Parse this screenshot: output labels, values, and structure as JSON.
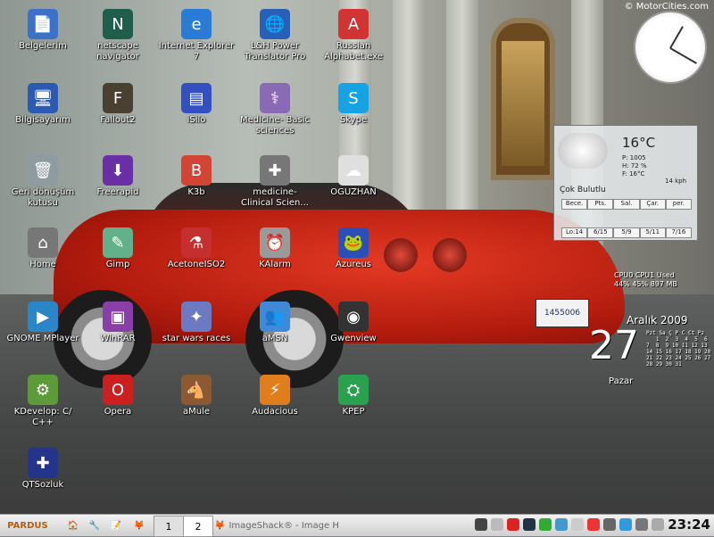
{
  "watermark": "© MotorCities.com",
  "desktop_icons": [
    {
      "label": "Belgelerim",
      "icon": "folder-documents-icon",
      "glyph": "📄",
      "bg": "#3d71c7"
    },
    {
      "label": "netscape navigator",
      "icon": "netscape-icon",
      "glyph": "N",
      "bg": "#1f5e4b"
    },
    {
      "label": "Internet Explorer 7",
      "icon": "ie-icon",
      "glyph": "e",
      "bg": "#2a7bd5"
    },
    {
      "label": "L&H Power Translator Pro",
      "icon": "globe-icon",
      "glyph": "🌐",
      "bg": "#2a5fb8"
    },
    {
      "label": "Russian Alphabet.exe",
      "icon": "russian-flag-icon",
      "glyph": "A",
      "bg": "#d23434"
    },
    {
      "label": "Bilgisayarım",
      "icon": "computer-icon",
      "glyph": "🖥",
      "bg": "#2c5ab0"
    },
    {
      "label": "Fallout2",
      "icon": "fallout-icon",
      "glyph": "F",
      "bg": "#4a4032"
    },
    {
      "label": "iSilo",
      "icon": "isilo-icon",
      "glyph": "▤",
      "bg": "#3450c0"
    },
    {
      "label": "Medicine- Basic sciences",
      "icon": "medicine-icon",
      "glyph": "⚕",
      "bg": "#8a6ab5"
    },
    {
      "label": "Skype",
      "icon": "skype-icon",
      "glyph": "S",
      "bg": "#16a3e3"
    },
    {
      "label": "Geri dönüşüm kutusu",
      "icon": "recycle-bin-icon",
      "glyph": "🗑",
      "bg": "#8e9ca2"
    },
    {
      "label": "Freerapid",
      "icon": "download-icon",
      "glyph": "⬇",
      "bg": "#6a2fa5"
    },
    {
      "label": "K3b",
      "icon": "k3b-icon",
      "glyph": "B",
      "bg": "#d24534"
    },
    {
      "label": "medicine- Clinical Scien...",
      "icon": "stethoscope-icon",
      "glyph": "✚",
      "bg": "#777777"
    },
    {
      "label": "OGUZHAN",
      "icon": "oguzhan-icon",
      "glyph": "☁",
      "bg": "#dfdfdf"
    },
    {
      "label": "Home",
      "icon": "home-icon",
      "glyph": "⌂",
      "bg": "#777777"
    },
    {
      "label": "Gimp",
      "icon": "gimp-icon",
      "glyph": "✎",
      "bg": "#63b18b"
    },
    {
      "label": "AcetoneISO2",
      "icon": "acetone-icon",
      "glyph": "⚗",
      "bg": "#c52f2f"
    },
    {
      "label": "KAlarm",
      "icon": "alarm-clock-icon",
      "glyph": "⏰",
      "bg": "#9a9a9a"
    },
    {
      "label": "Azureus",
      "icon": "azureus-icon",
      "glyph": "🐸",
      "bg": "#2b4fb8"
    },
    {
      "label": "GNOME MPlayer",
      "icon": "mplayer-icon",
      "glyph": "▶",
      "bg": "#2b86c7"
    },
    {
      "label": "WinRAR",
      "icon": "winrar-icon",
      "glyph": "▣",
      "bg": "#8a3fa8"
    },
    {
      "label": "star wars races",
      "icon": "starwars-icon",
      "glyph": "✦",
      "bg": "#6b7ac2"
    },
    {
      "label": "aMSN",
      "icon": "amsn-icon",
      "glyph": "👥",
      "bg": "#3f89d6"
    },
    {
      "label": "Gwenview",
      "icon": "gwenview-icon",
      "glyph": "◉",
      "bg": "#333333"
    },
    {
      "label": "KDevelop: C/ C++",
      "icon": "kdevelop-icon",
      "glyph": "⚙",
      "bg": "#5d9a39"
    },
    {
      "label": "Opera",
      "icon": "opera-icon",
      "glyph": "O",
      "bg": "#cc1f1f"
    },
    {
      "label": "aMule",
      "icon": "amule-icon",
      "glyph": "🐴",
      "bg": "#8b5a32"
    },
    {
      "label": "Audacious",
      "icon": "audacious-icon",
      "glyph": "⚡",
      "bg": "#e07d1d"
    },
    {
      "label": "KPEP",
      "icon": "kpep-icon",
      "glyph": "⛭",
      "bg": "#2aa14f"
    },
    {
      "label": "QTSozluk",
      "icon": "uk-flag-icon",
      "glyph": "✚",
      "bg": "#23348a"
    }
  ],
  "weather": {
    "temp": "16°C",
    "pressure": "P: 1005",
    "humidity": "H: 72 %",
    "feels": "F: 16°C",
    "wind": "14 kph",
    "condition": "Çok Bulutlu",
    "days": [
      "Bece.",
      "Pts.",
      "Sal.",
      "Çar.",
      "per."
    ],
    "temps": [
      "Lo:14",
      "6/15",
      "5/9",
      "5/11",
      "7/16"
    ]
  },
  "sysmon": {
    "header": "CPU0  CPU1   Used",
    "values": "44%   45%  897 MB"
  },
  "date": {
    "month": "Aralık 2009",
    "day": "27",
    "weekday": "Pazar",
    "calendar": "Pzt Sa Ç P C Ct Pz\n   1  2  3  4  5  6\n7  8  9 10 11 12 13\n14 15 16 17 18 19 20\n21 22 23 24 25 26 27\n28 29 30 31"
  },
  "taskbar": {
    "start": "PARDUS",
    "pager": [
      "1",
      "2"
    ],
    "task": "ImageShack® - Image H",
    "time": "23:24"
  }
}
